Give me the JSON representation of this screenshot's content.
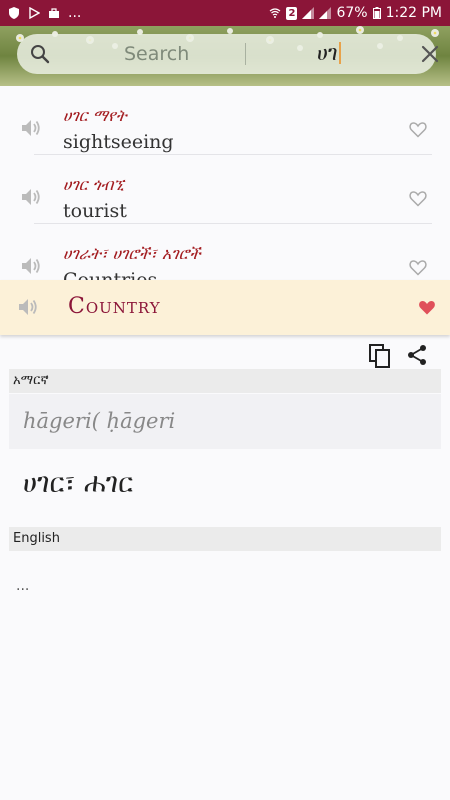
{
  "status_bar": {
    "left_icons": [
      "shield-icon",
      "play-store-icon",
      "bag-icon",
      "more-icon"
    ],
    "more_text": "...",
    "sim_badge": "2",
    "battery": "67%",
    "time": "1:22 PM"
  },
  "search": {
    "placeholder": "Search",
    "value": "ሀገ"
  },
  "results": [
    {
      "amharic": "ሀገር ማየት",
      "english": "sightseeing",
      "favorite": false
    },
    {
      "amharic": "ሀገር ጎብኚ",
      "english": "tourist",
      "favorite": false
    },
    {
      "amharic": "ሀገራት፣ ሀገሮች፣ አገሮች",
      "english": "Countries",
      "favorite": false
    }
  ],
  "selected": {
    "word": "Country",
    "favorite": true
  },
  "detail": {
    "amharic_section_label": "አማርኛ",
    "transliteration": "hāgeri( ḥāgeri",
    "amharic_word": "ሀገር፣ ሐገር",
    "english_section_label": "English",
    "english_content": "..."
  },
  "colors": {
    "primary": "#8b1538",
    "amharic_text": "#a31c20",
    "selected_bg": "#fcf1d8",
    "heart_active": "#e0505a"
  }
}
